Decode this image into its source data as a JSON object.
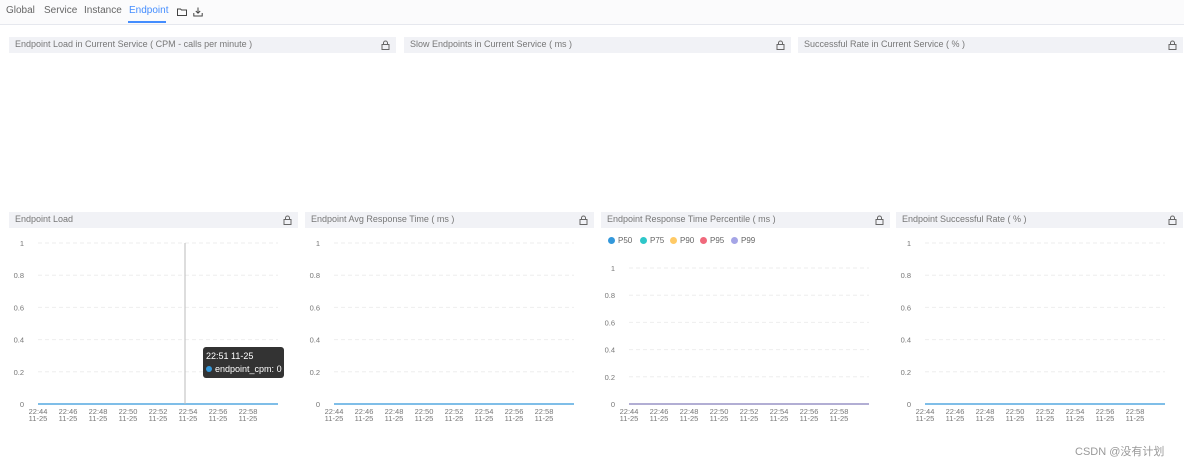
{
  "tabs": [
    {
      "label": "Global"
    },
    {
      "label": "Service"
    },
    {
      "label": "Instance"
    },
    {
      "label": "Endpoint",
      "active": true
    }
  ],
  "toolbar_icons": [
    "folder-icon",
    "download-icon"
  ],
  "top_panels": [
    {
      "title": "Endpoint Load in Current Service ( CPM - calls per minute )"
    },
    {
      "title": "Slow Endpoints in Current Service ( ms )"
    },
    {
      "title": "Successful Rate in Current Service ( % )"
    }
  ],
  "tooltip": {
    "time": "22:51 11-25",
    "series": "endpoint_cpm",
    "value": "0",
    "color": "#3398db"
  },
  "watermark": "CSDN @没有计划",
  "colors": {
    "accent": "#448dfe",
    "line": "#3398db"
  },
  "chart_data": [
    {
      "type": "line",
      "title": "Endpoint Load",
      "x": [
        "22:44\n11-25",
        "22:46\n11-25",
        "22:48\n11-25",
        "22:50\n11-25",
        "22:52\n11-25",
        "22:54\n11-25",
        "22:56\n11-25",
        "22:58\n11-25"
      ],
      "ytick_labels": [
        "1",
        "0.8",
        "0.6",
        "0.4",
        "0.2",
        "0"
      ],
      "ylim": [
        0,
        1
      ],
      "series": [
        {
          "values": [
            0,
            0,
            0,
            0,
            0,
            0,
            0,
            0
          ],
          "color": "#3398db"
        }
      ],
      "grid": true
    },
    {
      "type": "line",
      "title": "Endpoint Avg Response Time ( ms )",
      "x": [
        "22:44\n11-25",
        "22:46\n11-25",
        "22:48\n11-25",
        "22:50\n11-25",
        "22:52\n11-25",
        "22:54\n11-25",
        "22:56\n11-25",
        "22:58\n11-25"
      ],
      "ytick_labels": [
        "1",
        "0.8",
        "0.6",
        "0.4",
        "0.2",
        "0"
      ],
      "ylim": [
        0,
        1
      ],
      "series": [
        {
          "values": [
            0,
            0,
            0,
            0,
            0,
            0,
            0,
            0
          ],
          "color": "#3398db"
        }
      ],
      "grid": true
    },
    {
      "type": "line",
      "title": "Endpoint Response Time Percentile ( ms )",
      "x": [
        "22:44\n11-25",
        "22:46\n11-25",
        "22:48\n11-25",
        "22:50\n11-25",
        "22:52\n11-25",
        "22:54\n11-25",
        "22:56\n11-25",
        "22:58\n11-25"
      ],
      "ytick_labels": [
        "1",
        "0.8",
        "0.6",
        "0.4",
        "0.2",
        "0"
      ],
      "ylim": [
        0,
        1
      ],
      "legend": "top-left",
      "series": [
        {
          "name": "P50",
          "values": [
            0,
            0,
            0,
            0,
            0,
            0,
            0,
            0
          ],
          "color": "#3398db"
        },
        {
          "name": "P75",
          "values": [
            0,
            0,
            0,
            0,
            0,
            0,
            0,
            0
          ],
          "color": "#2ec7c9"
        },
        {
          "name": "P90",
          "values": [
            0,
            0,
            0,
            0,
            0,
            0,
            0,
            0
          ],
          "color": "#ffca66"
        },
        {
          "name": "P95",
          "values": [
            0,
            0,
            0,
            0,
            0,
            0,
            0,
            0
          ],
          "color": "#f0697c"
        },
        {
          "name": "P99",
          "values": [
            0,
            0,
            0,
            0,
            0,
            0,
            0,
            0
          ],
          "color": "#a5a5e6"
        }
      ],
      "grid": true
    },
    {
      "type": "line",
      "title": "Endpoint Successful Rate ( % )",
      "x": [
        "22:44\n11-25",
        "22:46\n11-25",
        "22:48\n11-25",
        "22:50\n11-25",
        "22:52\n11-25",
        "22:54\n11-25",
        "22:56\n11-25",
        "22:58\n11-25"
      ],
      "ytick_labels": [
        "1",
        "0.8",
        "0.6",
        "0.4",
        "0.2",
        "0"
      ],
      "ylim": [
        0,
        1
      ],
      "series": [
        {
          "values": [
            0,
            0,
            0,
            0,
            0,
            0,
            0,
            0
          ],
          "color": "#3398db"
        }
      ],
      "grid": true
    }
  ]
}
